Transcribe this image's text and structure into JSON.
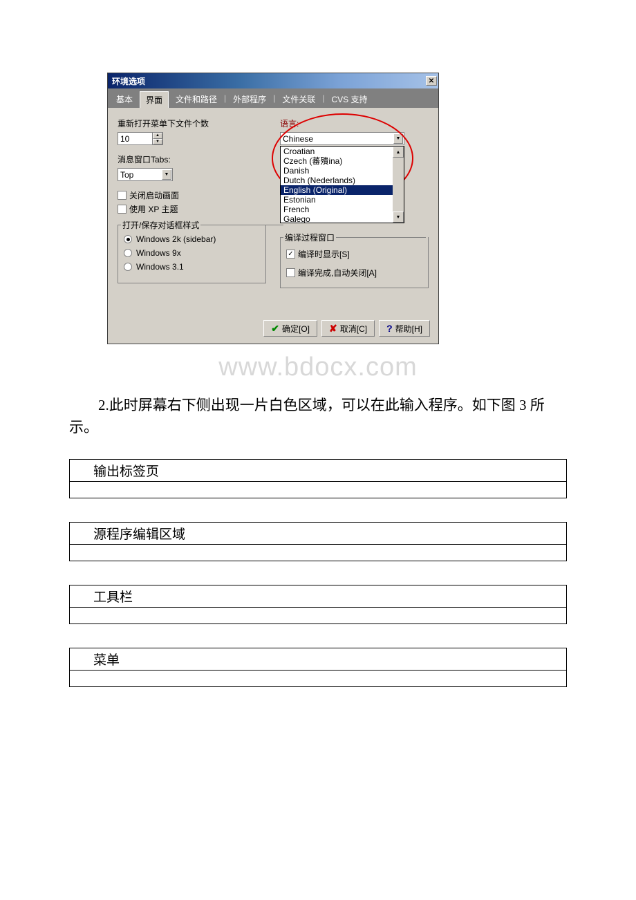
{
  "dialog": {
    "title": "环境选项",
    "tabs": [
      "基本",
      "界面",
      "文件和路径",
      "外部程序",
      "文件关联",
      "CVS 支持"
    ],
    "reopen_label": "重新打开菜单下文件个数",
    "reopen_value": "10",
    "msgtab_label": "消息窗口Tabs:",
    "msgtab_value": "Top",
    "cb_splash": "关闭启动画面",
    "cb_xptheme": "使用 XP 主题",
    "group_dialog": "打开/保存对话框样式",
    "radios": [
      "Windows 2k (sidebar)",
      "Windows 9x",
      "Windows 3.1"
    ],
    "lang_label": "语言:",
    "lang_value": "Chinese",
    "lang_list": [
      "Croatian",
      "Czech (蕃殨ina)",
      "Danish",
      "Dutch (Nederlands)",
      "English (Original)",
      "Estonian",
      "French",
      "Galego"
    ],
    "group_compile": "编译过程窗口",
    "cb_showcompile": "编译时显示[S]",
    "cb_autoclose": "编译完成,自动关闭[A]",
    "btn_ok": "确定[O]",
    "btn_cancel": "取消[C]",
    "btn_help": "帮助[H]"
  },
  "watermark": "www.bdocx.com",
  "para": "2.此时屏幕右下侧出现一片白色区域，可以在此输入程序。如下图 3 所示。",
  "boxes": [
    "输出标签页",
    "源程序编辑区域",
    "工具栏",
    "菜单"
  ]
}
